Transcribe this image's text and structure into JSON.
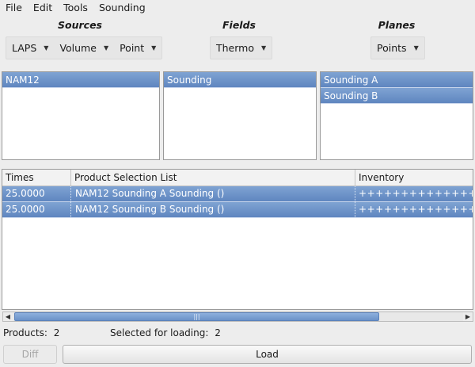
{
  "menu": [
    "File",
    "Edit",
    "Tools",
    "Sounding"
  ],
  "sources": {
    "title": "Sources",
    "dropdowns": [
      "LAPS",
      "Volume",
      "Point"
    ],
    "items": [
      "NAM12"
    ]
  },
  "fields": {
    "title": "Fields",
    "dropdowns": [
      "Thermo"
    ],
    "items": [
      "Sounding"
    ]
  },
  "planes": {
    "title": "Planes",
    "dropdowns": [
      "Points"
    ],
    "items": [
      "Sounding A",
      "Sounding B"
    ]
  },
  "table": {
    "columns": [
      "Times",
      "Product Selection List",
      "Inventory"
    ],
    "rows": [
      {
        "time": "25.0000",
        "product": "NAM12 Sounding A Sounding ()",
        "inventory": "+++++++++++++++++"
      },
      {
        "time": "25.0000",
        "product": "NAM12 Sounding B Sounding ()",
        "inventory": "+++++++++++++++++"
      }
    ]
  },
  "status": {
    "products_label": "Products:",
    "products_count": "2",
    "selected_label": "Selected for loading:",
    "selected_count": "2"
  },
  "buttons": {
    "diff": "Diff",
    "load": "Load"
  },
  "colors": {
    "selection": "#6b92c8",
    "background": "#ededed"
  }
}
